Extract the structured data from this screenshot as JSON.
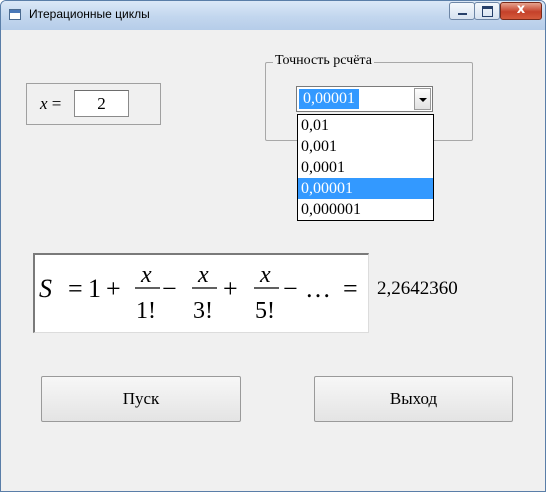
{
  "window": {
    "title": "Итерационные циклы",
    "close_glyph": "x"
  },
  "x_panel": {
    "label_var": "x",
    "label_eq": "=",
    "value": "2"
  },
  "precision": {
    "group_label": "Точность рсчёта",
    "selected_value": "0,00001",
    "options": [
      "0,01",
      "0,001",
      "0,0001",
      "0,00001",
      "0,000001"
    ],
    "highlighted_index": 3
  },
  "formula": {
    "lhs": "S",
    "eq": "=",
    "one": "1",
    "plus": "+",
    "minus": "−",
    "numerator": "x",
    "denominators": [
      "1!",
      "3!",
      "5!"
    ],
    "ellipsis": "…",
    "eq2": "="
  },
  "result": "2,2642360",
  "buttons": {
    "run": "Пуск",
    "exit": "Выход"
  }
}
